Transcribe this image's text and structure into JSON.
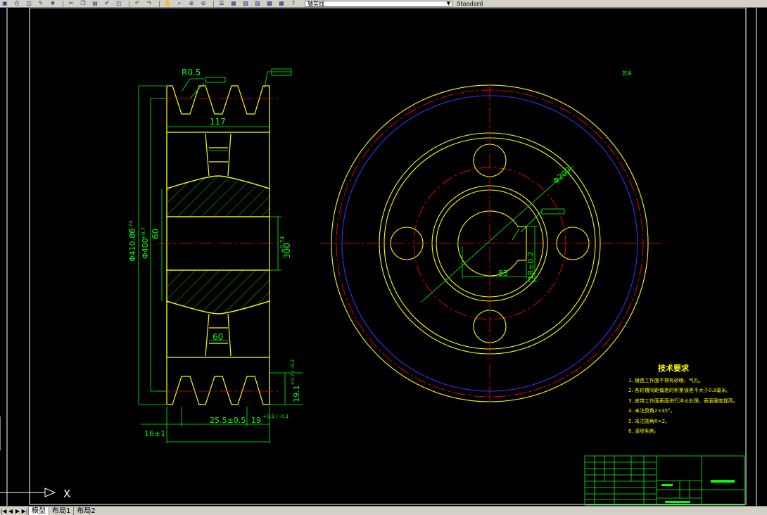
{
  "toolbar": {
    "buttons": [
      {
        "icon": "save-icon",
        "glyph": "▣"
      },
      {
        "icon": "print-icon",
        "glyph": "⎙"
      },
      {
        "icon": "preview-icon",
        "glyph": "◫"
      },
      {
        "icon": "plot-icon",
        "glyph": "✎"
      },
      {
        "icon": "publish-icon",
        "glyph": "❖"
      },
      {
        "icon": "cut-icon",
        "glyph": "✂"
      },
      {
        "icon": "copy-icon",
        "glyph": "❐"
      },
      {
        "icon": "paste-icon",
        "glyph": "▤"
      },
      {
        "icon": "match-properties-icon",
        "glyph": "✐"
      },
      {
        "icon": "block-editor-icon",
        "glyph": "◰"
      },
      {
        "icon": "undo-icon",
        "glyph": "↶"
      },
      {
        "icon": "redo-icon",
        "glyph": "↷"
      },
      {
        "icon": "pan-icon",
        "glyph": "✋"
      },
      {
        "icon": "zoom-realtime-icon",
        "glyph": "⌕"
      },
      {
        "icon": "zoom-window-icon",
        "glyph": "⊕"
      },
      {
        "icon": "zoom-previous-icon",
        "glyph": "⊖"
      },
      {
        "icon": "properties-icon",
        "glyph": "☰"
      },
      {
        "icon": "design-center-icon",
        "glyph": "▦"
      },
      {
        "icon": "tool-palette-icon",
        "glyph": "▧"
      },
      {
        "icon": "sheet-set-icon",
        "glyph": "▨"
      },
      {
        "icon": "markup-icon",
        "glyph": "▩"
      },
      {
        "icon": "calculator-icon",
        "glyph": "▦"
      },
      {
        "icon": "help-icon",
        "glyph": "?"
      }
    ],
    "layer_name": "轴实线",
    "text_style": "Standard",
    "colors": {
      "face": "#d4d0c8",
      "shadow": "#808080"
    }
  },
  "tabs": {
    "model": "模型",
    "layout1": "布局1",
    "layout2": "布局2"
  },
  "ucs": {
    "x_label": "X"
  },
  "drawing": {
    "left_view": {
      "r_label": "R0.5",
      "width_117": "117",
      "dim_60_top": "60",
      "dim_60_hub": "60",
      "bore_tol": "+0.74",
      "bore_300": "300",
      "dia_410": "Φ410.86",
      "dia_410_tol": "+0.74",
      "dia_400": "Φ400",
      "dia_400_tol": "+0.7",
      "dim_16": "16±1",
      "dim_25": "25.5±0.5",
      "dim_19": "19",
      "dim_19_tol": "+0.3 / -0.1",
      "dim_19r": "19.1",
      "dim_19r_tol": "+0.7 / -0.2"
    },
    "right_view": {
      "dim_200": "Φ200",
      "dim_83": "83",
      "dim_18": "18±0.2",
      "label_rest": "其余"
    },
    "tech": {
      "title": "技术要求",
      "items": [
        "1. 铸造工作面不得有砂眼、气孔。",
        "2. 各轮槽间距偏差的积累误差不大于0.8毫米。",
        "3. 皮带工作面表面进行淬火处理，表面硬度提高。",
        "4. 未注倒角2×45°。",
        "5. 未注圆角R=2。",
        "6. 清除毛刺。"
      ]
    }
  }
}
